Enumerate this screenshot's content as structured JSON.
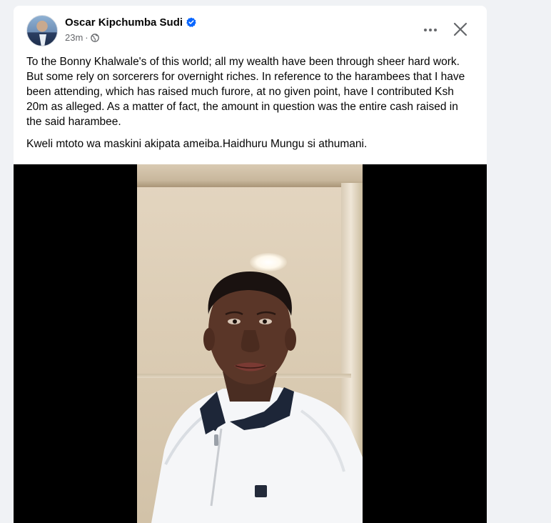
{
  "post": {
    "author": "Oscar Kipchumba Sudi",
    "verified": true,
    "time": "23m",
    "separator": "·",
    "audience_icon": "globe-icon",
    "paragraphs": [
      "To the Bonny Khalwale's of  this world; all my wealth have been through sheer hard work. But some rely on sorcerers for overnight riches. In reference to the harambees that I have been attending, which has raised much furore, at no given point, have I contributed Ksh 20m as alleged.  As a matter of fact, the amount in question was the entire cash raised in the said harambee.",
      "Kweli mtoto wa maskini akipata ameiba.Haidhuru Mungu si athumani."
    ]
  },
  "icons": {
    "more": "more-options-icon",
    "close": "close-icon",
    "verified": "verified-badge-icon"
  },
  "colors": {
    "background": "#f0f2f5",
    "card": "#ffffff",
    "text": "#050505",
    "secondary_text": "#65676b",
    "verified_blue": "#0866ff",
    "video_background": "#000000"
  }
}
